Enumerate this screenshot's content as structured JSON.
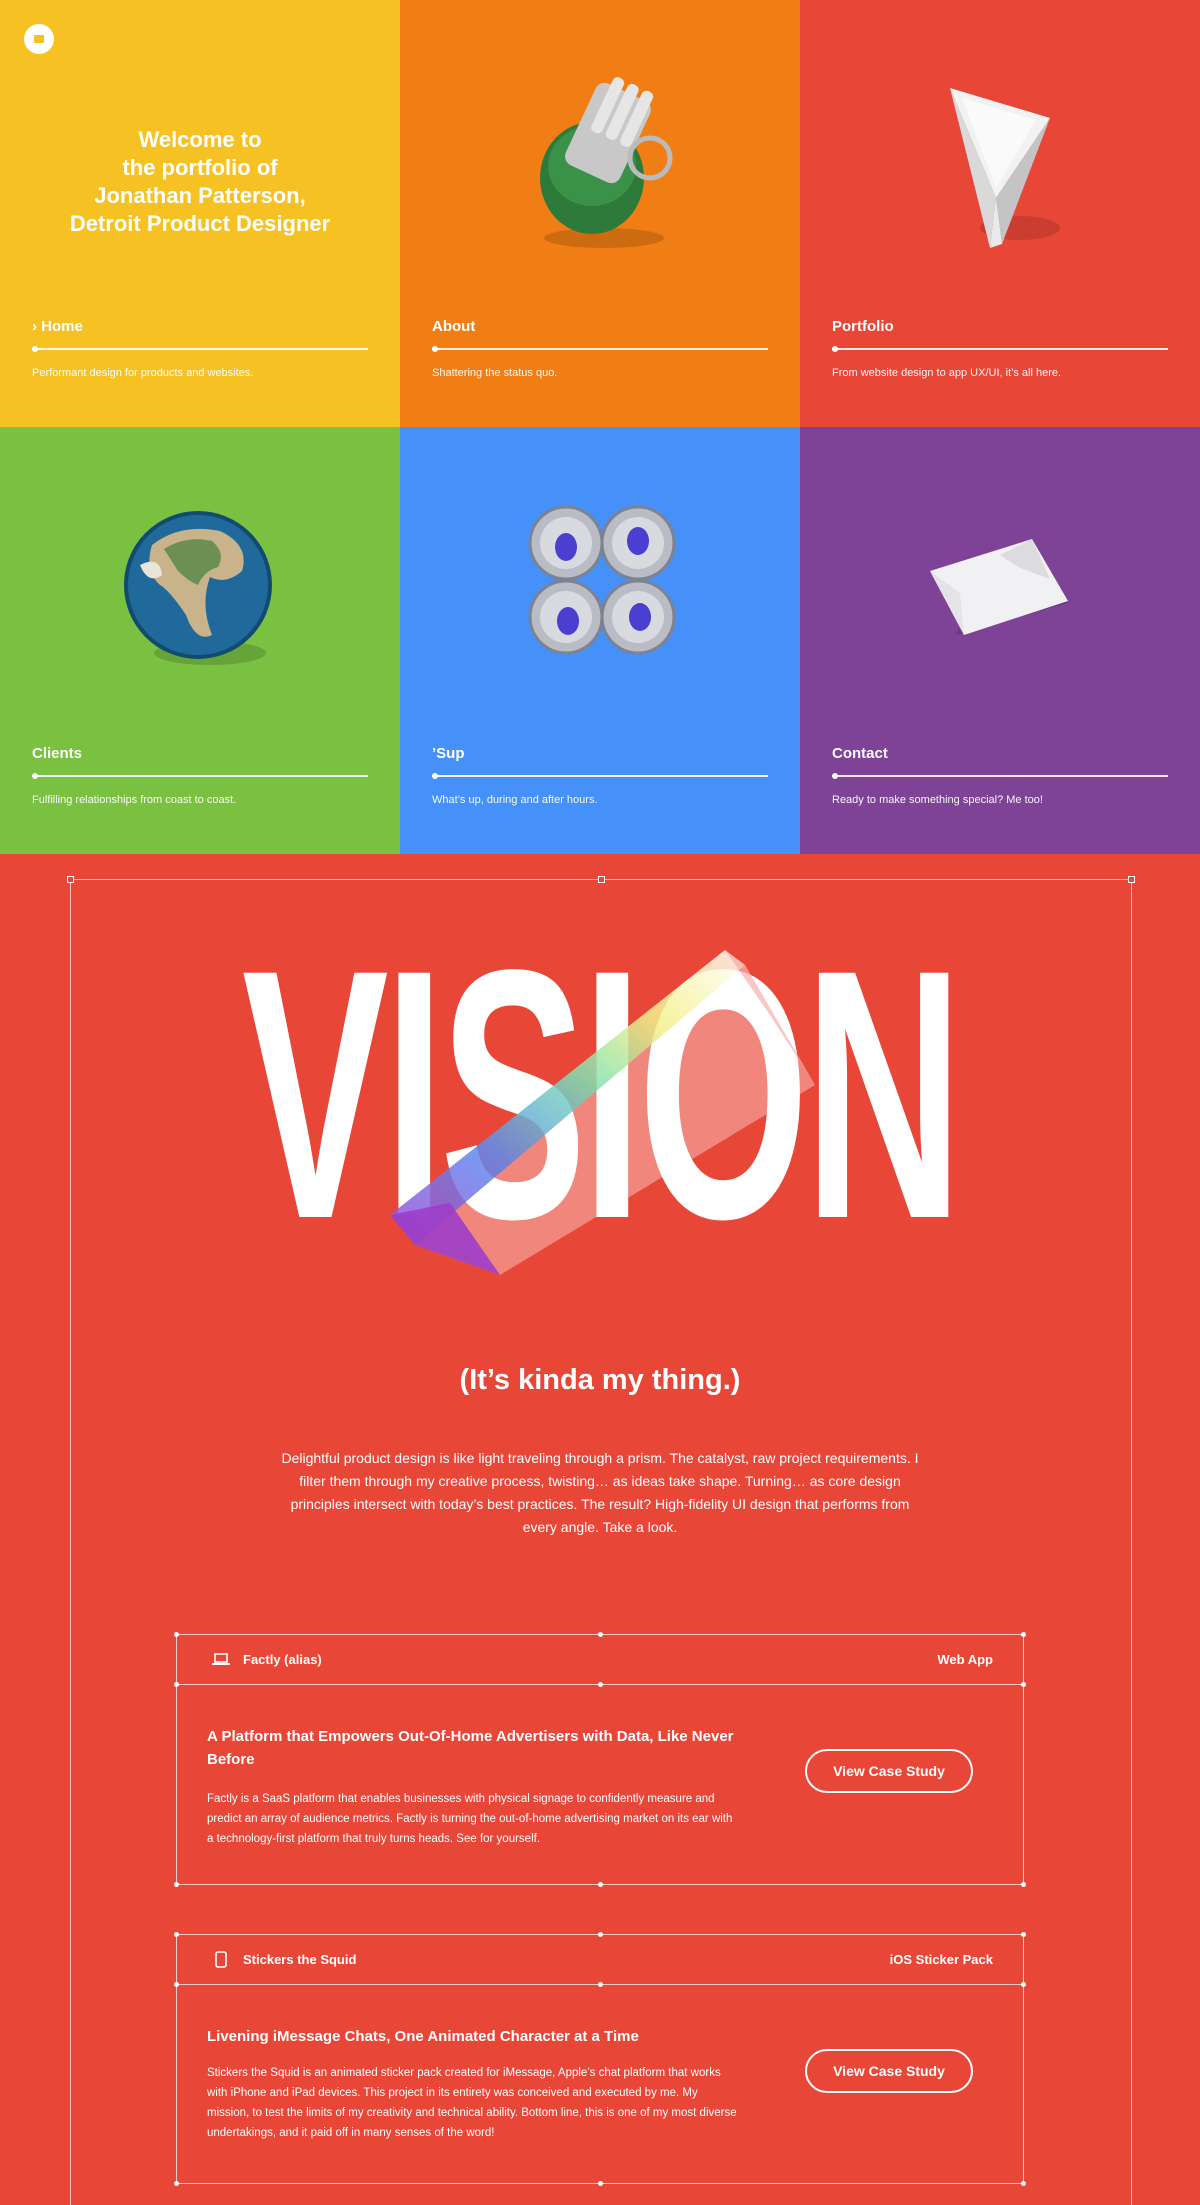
{
  "welcome": {
    "lines": [
      "Welcome to",
      "the portfolio of",
      "Jonathan Patterson,",
      "Detroit Product Designer"
    ]
  },
  "tiles": [
    {
      "label": "› Home",
      "desc": "Performant design for products and websites.",
      "color": "#f6c223",
      "object_icon": "logo-icon"
    },
    {
      "label": "About",
      "desc": "Shattering the status quo.",
      "color": "#f17e15",
      "object_icon": "grenade-icon"
    },
    {
      "label": "Portfolio",
      "desc": "From website design to app UX/UI, it’s all here.",
      "color": "#e84637",
      "object_icon": "prism-icon"
    },
    {
      "label": "Clients",
      "desc": "Fulfilling relationships from coast to coast.",
      "color": "#7ac141",
      "object_icon": "globe-icon"
    },
    {
      "label": "’Sup",
      "desc": "What’s up, during and after hours.",
      "color": "#4590f9",
      "object_icon": "cans-icon"
    },
    {
      "label": "Contact",
      "desc": "Ready to make something special? Me too!",
      "color": "#7e4397",
      "object_icon": "paper-icon"
    }
  ],
  "vision": {
    "headline": "VISION",
    "subhead": "(It’s kinda my thing.)",
    "intro": "Delightful product design is like light traveling through a prism. The catalyst, raw project requirements. I filter them through my creative process, twisting… as ideas take shape. Turning… as core design principles intersect with today’s best practices. The result? High-fidelity UI design that performs from every angle. Take a look."
  },
  "projects": [
    {
      "icon": "laptop-icon",
      "name": "Factly (alias)",
      "type": "Web App",
      "title": "A Platform that Empowers Out-Of-Home Advertisers with Data, Like Never Before",
      "text": "Factly is a SaaS platform that enables businesses with physical signage to confidently measure and predict an array of audience metrics. Factly is turning the out-of-home advertising market on its ear with a technology-first platform that truly turns heads. See for yourself.",
      "cta": "View Case Study"
    },
    {
      "icon": "phone-icon",
      "name": "Stickers the Squid",
      "type": "iOS Sticker Pack",
      "title": "Livening iMessage Chats, One Animated Character at a Time",
      "text": "Stickers the Squid is an animated sticker pack created for iMessage, Apple’s chat platform that works with iPhone and iPad devices. This project in its entirety was conceived and executed by me. My mission, to test the limits of my creativity and technical ability. Bottom line, this is one of my most diverse undertakings, and it paid off in many senses of the word!",
      "cta": "View Case Study"
    }
  ],
  "colors": {
    "accent": "#e84637",
    "yellow": "#f6c223",
    "orange": "#f17e15",
    "green": "#7ac141",
    "blue": "#4590f9",
    "purple": "#7e4397"
  }
}
